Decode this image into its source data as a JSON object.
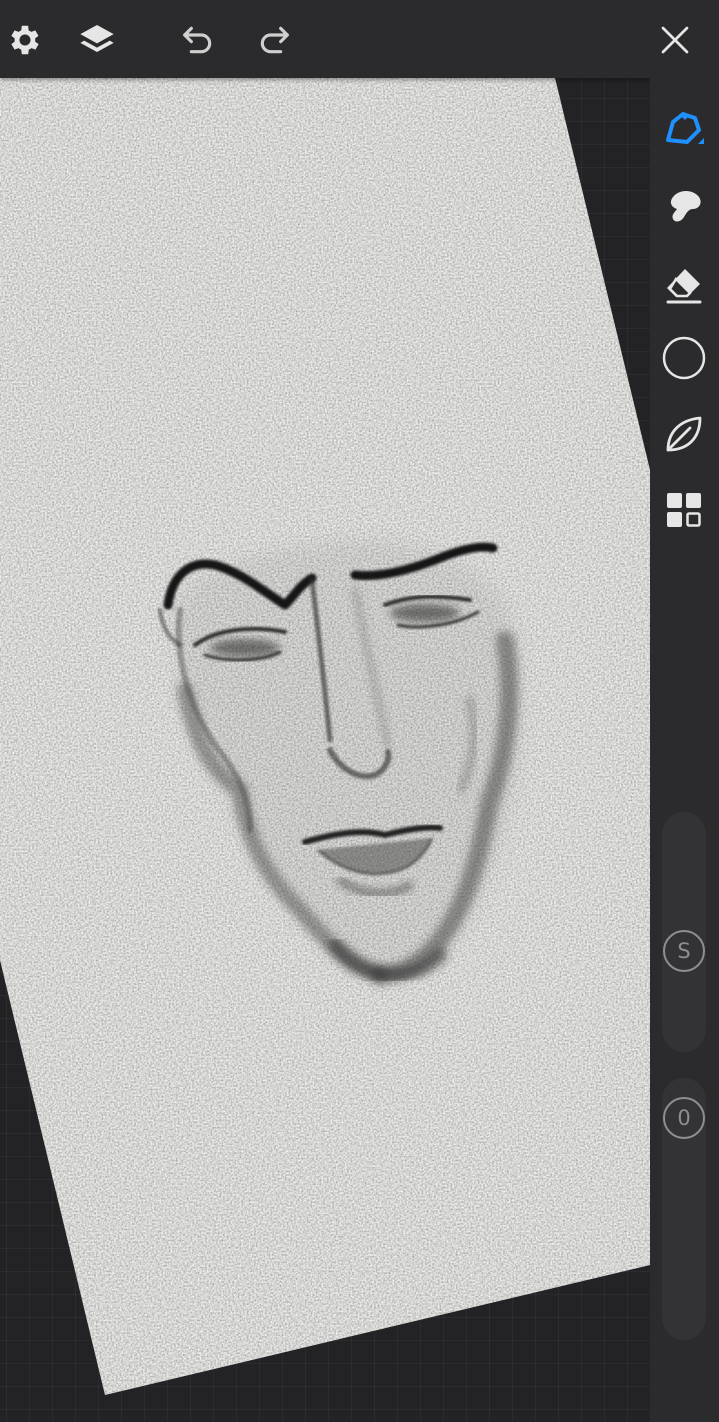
{
  "app": {
    "accent_color": "#1e90ff",
    "icon_color": "#e6e6e6"
  },
  "topbar": {
    "settings_icon": "gear-icon",
    "layers_icon": "layers-icon",
    "undo_icon": "undo-icon",
    "redo_icon": "redo-icon",
    "close_icon": "close-icon"
  },
  "tools": [
    {
      "name": "brush-tool",
      "icon": "brush-icon",
      "selected": true
    },
    {
      "name": "smudge-tool",
      "icon": "smudge-icon",
      "selected": false
    },
    {
      "name": "eraser-tool",
      "icon": "eraser-icon",
      "selected": false
    },
    {
      "name": "color-picker",
      "icon": "color-circle-icon",
      "selected": false,
      "color": "#2b2b2d"
    },
    {
      "name": "selection-tool",
      "icon": "leaf-selection-icon",
      "selected": false
    },
    {
      "name": "more-tools",
      "icon": "grid-icon",
      "selected": false
    }
  ],
  "sliders": {
    "size_label": "S",
    "opacity_label": "0"
  },
  "canvas": {
    "paper_color": "#f4f4f2",
    "background_grid": true
  }
}
